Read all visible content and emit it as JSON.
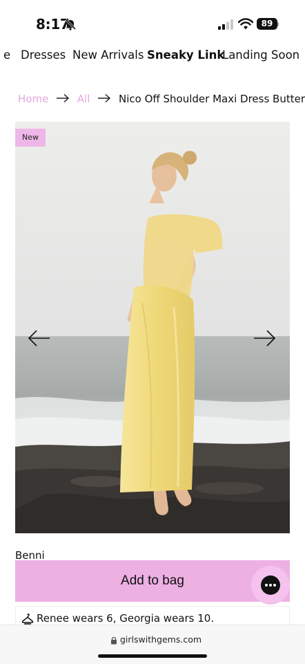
{
  "status_bar": {
    "time": "8:17",
    "battery": "89"
  },
  "nav": {
    "items": [
      {
        "label": "e",
        "active": false
      },
      {
        "label": "Dresses",
        "active": false
      },
      {
        "label": "New Arrivals",
        "active": false
      },
      {
        "label": "Sneaky Link",
        "active": true
      },
      {
        "label": "Landing Soon",
        "active": false
      }
    ]
  },
  "breadcrumb": {
    "home": "Home",
    "all": "All",
    "current": "Nico Off Shoulder Maxi Dress Butter"
  },
  "product": {
    "badge": "New",
    "model_name": "Benni",
    "add_to_bag": "Add to bag",
    "size_note": "Renee wears 6, Georgia wears 10."
  },
  "browser": {
    "url": "girlswithgems.com"
  },
  "colors": {
    "accent_pink": "#edb0e3",
    "breadcrumb_link": "#e5a6df",
    "dress_yellow": "#f1dc86"
  },
  "icons": {
    "notification": "bell-slash-icon",
    "signal": "cellular-signal-icon",
    "wifi": "wifi-icon",
    "prev": "arrow-left-icon",
    "next": "arrow-right-icon",
    "chat": "chat-bubble-icon",
    "size": "hanger-icon",
    "lock": "lock-icon"
  }
}
